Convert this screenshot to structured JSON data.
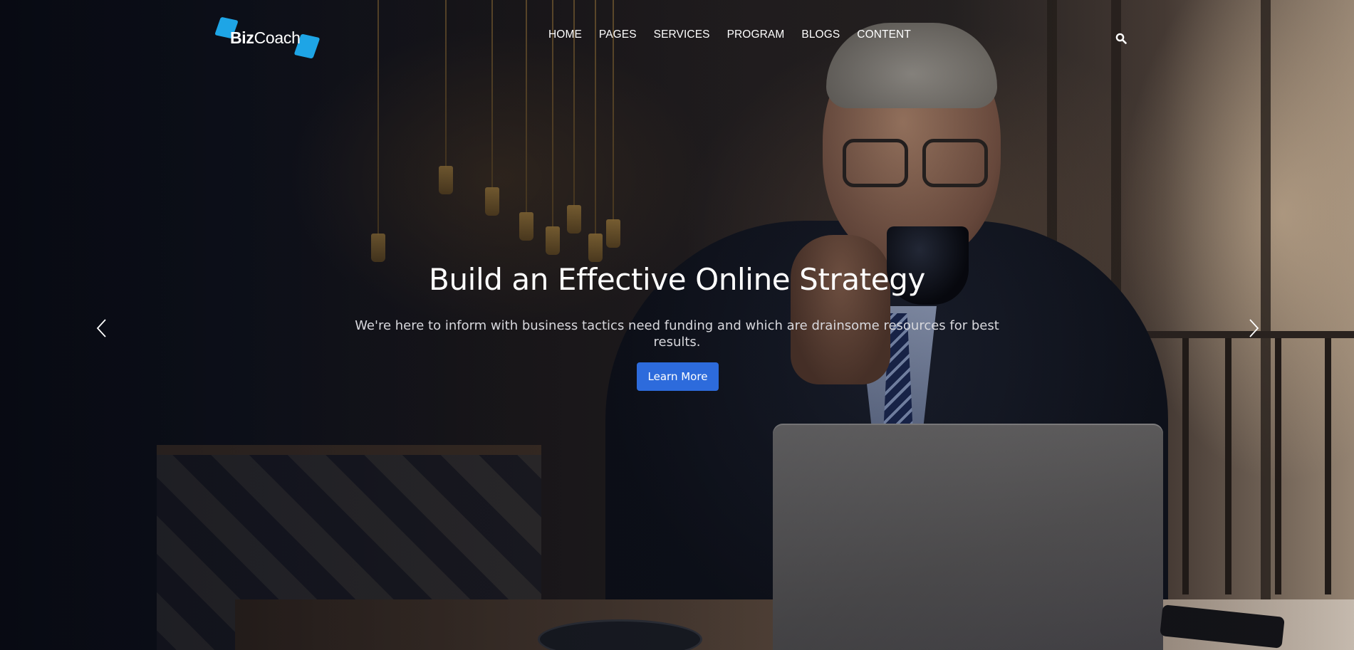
{
  "header": {
    "logo": {
      "bold": "Biz",
      "regular": "Coach"
    },
    "nav": [
      "HOME",
      "PAGES",
      "SERVICES",
      "PROGRAM",
      "BLOGS",
      "CONTENT"
    ],
    "search_icon": "search-icon"
  },
  "slide": {
    "title": "Build an Effective Online Strategy",
    "description": "We're here to inform with business tactics need funding and which are drainsome resources for best results.",
    "button_label": "Learn More"
  },
  "controls": {
    "prev_icon": "chevron-left-icon",
    "next_icon": "chevron-right-icon"
  },
  "colors": {
    "accent": "#2d6bdc",
    "logo_blue": "#1ea5e6",
    "text": "#ffffff"
  }
}
